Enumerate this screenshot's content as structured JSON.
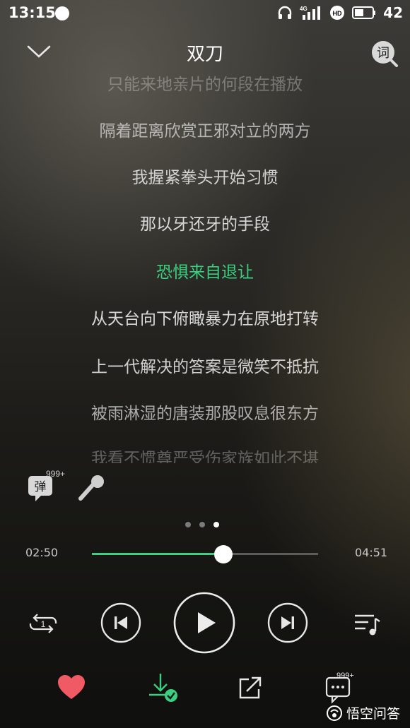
{
  "status_bar": {
    "time": "13:15",
    "network": "4G",
    "hd_label": "HD",
    "battery": "42"
  },
  "header": {
    "title": "双刀",
    "lyric_mode_label": "词"
  },
  "lyrics": {
    "lines": [
      "只能来地亲片的何段在播放",
      "隔着距离欣赏正邪对立的两方",
      "我握紧拳头开始习惯",
      "那以牙还牙的手段",
      "恐惧来自退让",
      "从天台向下俯瞰暴力在原地打转",
      "上一代解决的答案是微笑不抵抗",
      "被雨淋湿的唐装那股叹息很东方",
      "我看不惯尊严受伤家族如此不堪"
    ],
    "active_index": 4
  },
  "danmu": {
    "label": "弹",
    "count": "999+"
  },
  "pager": {
    "pages": 3,
    "current": 2
  },
  "player": {
    "elapsed": "02:50",
    "total": "04:51",
    "progress": 0.58
  },
  "bottom_bar": {
    "comment_count": "999+"
  },
  "watermark": {
    "text": "悟空问答"
  },
  "colors": {
    "accent": "#3bd07f",
    "heart": "#f05a64"
  }
}
